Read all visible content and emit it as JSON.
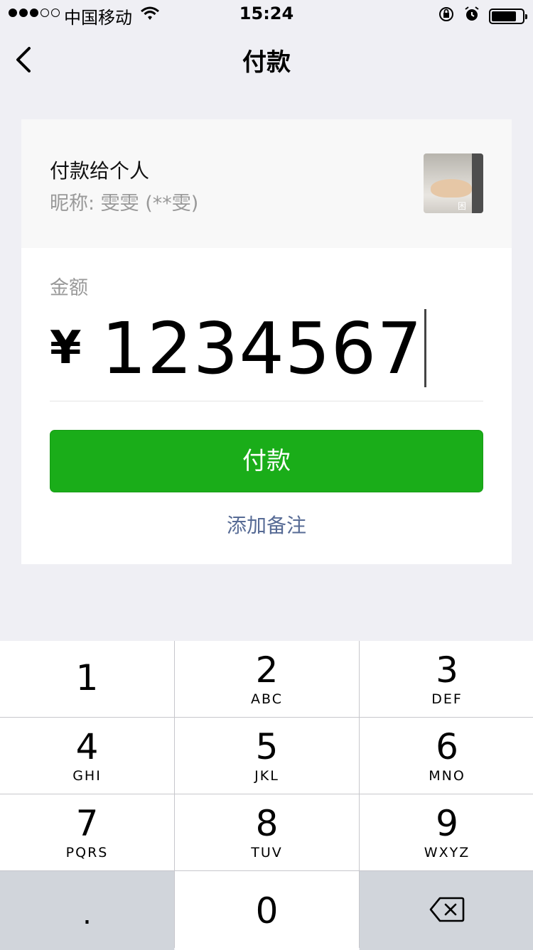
{
  "status_bar": {
    "carrier": "中国移动",
    "time": "15:24",
    "signal_bars_filled": 3,
    "battery_level": 0.8
  },
  "nav": {
    "title": "付款",
    "back_icon": "chevron-left-icon"
  },
  "payee": {
    "title": "付款给个人",
    "nickname": "昵称: 雯雯 (**雯)",
    "avatar_tag": "困"
  },
  "amount": {
    "label": "金额",
    "currency": "¥",
    "value": "1234567"
  },
  "actions": {
    "pay_label": "付款",
    "add_note_label": "添加备注"
  },
  "keypad": {
    "keys": [
      {
        "digit": "1",
        "letters": ""
      },
      {
        "digit": "2",
        "letters": "ABC"
      },
      {
        "digit": "3",
        "letters": "DEF"
      },
      {
        "digit": "4",
        "letters": "GHI"
      },
      {
        "digit": "5",
        "letters": "JKL"
      },
      {
        "digit": "6",
        "letters": "MNO"
      },
      {
        "digit": "7",
        "letters": "PQRS"
      },
      {
        "digit": "8",
        "letters": "TUV"
      },
      {
        "digit": "9",
        "letters": "WXYZ"
      }
    ],
    "dot": ".",
    "zero": "0",
    "delete_icon": "backspace-icon"
  },
  "colors": {
    "accent_green": "#1aad19",
    "link_blue": "#576b95",
    "background": "#efeff4"
  }
}
